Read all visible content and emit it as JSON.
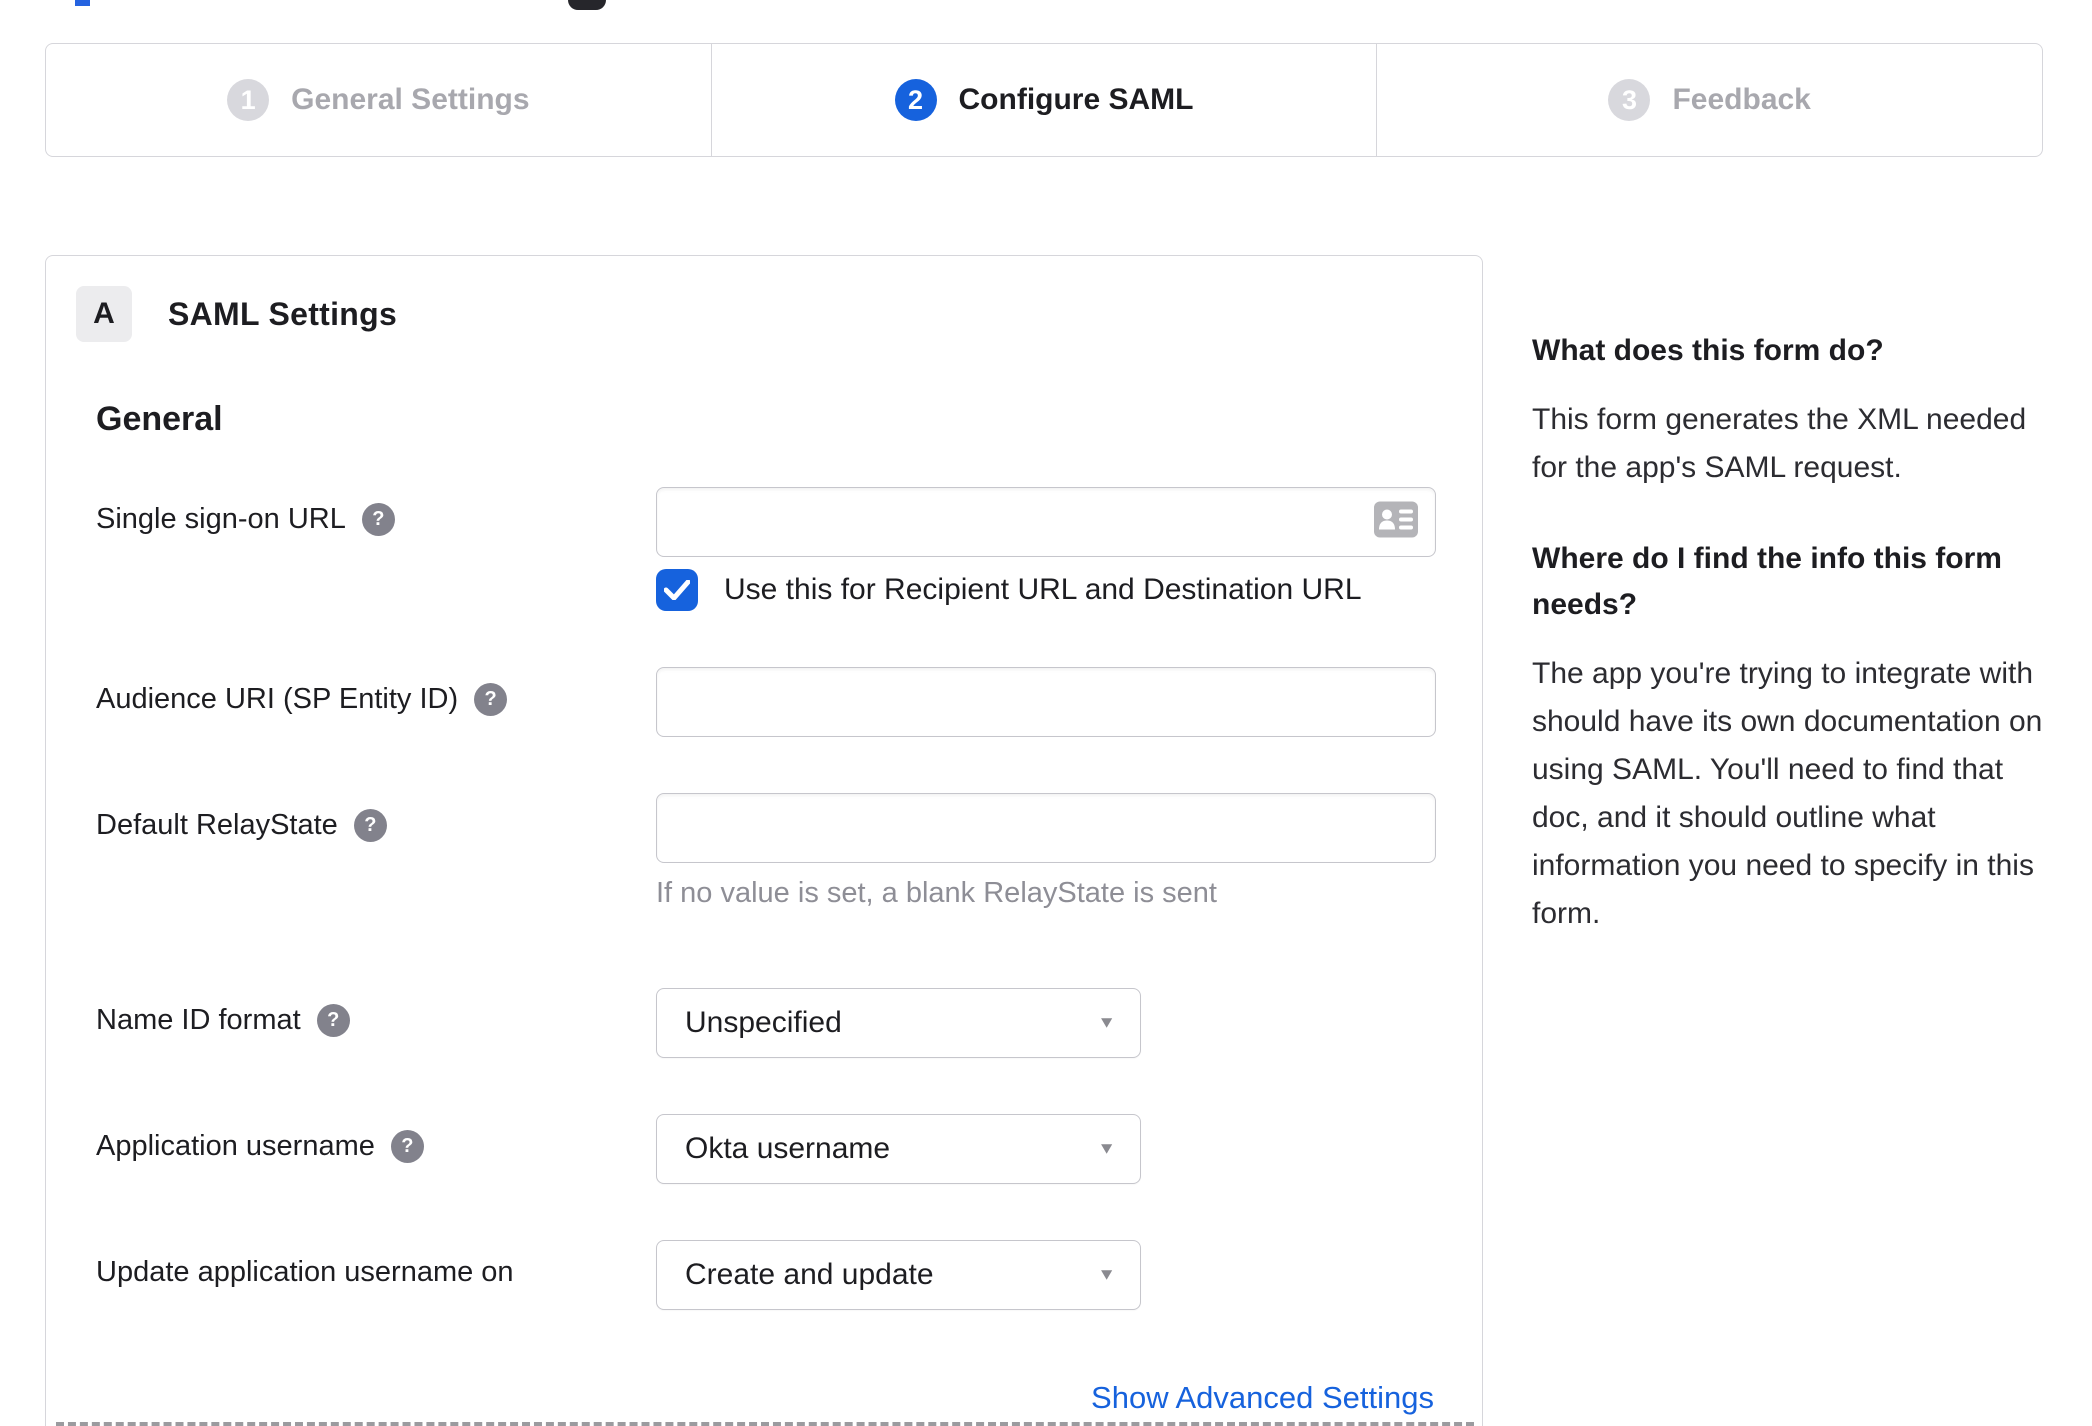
{
  "stepper": {
    "steps": [
      {
        "number": "1",
        "label": "General Settings",
        "state": "inactive"
      },
      {
        "number": "2",
        "label": "Configure SAML",
        "state": "active"
      },
      {
        "number": "3",
        "label": "Feedback",
        "state": "inactive"
      }
    ]
  },
  "panel": {
    "section_badge": "A",
    "section_title": "SAML Settings",
    "group_title": "General",
    "fields": {
      "sso_url": {
        "label": "Single sign-on URL",
        "value": "",
        "checkbox_label": "Use this for Recipient URL and Destination URL",
        "checkbox_checked": true
      },
      "audience_uri": {
        "label": "Audience URI (SP Entity ID)",
        "value": ""
      },
      "default_relaystate": {
        "label": "Default RelayState",
        "value": "",
        "hint": "If no value is set, a blank RelayState is sent"
      },
      "name_id_format": {
        "label": "Name ID format",
        "value": "Unspecified"
      },
      "app_username": {
        "label": "Application username",
        "value": "Okta username"
      },
      "update_app_username": {
        "label": "Update application username on",
        "value": "Create and update"
      }
    },
    "advanced_link": "Show Advanced Settings"
  },
  "sidebar": {
    "blocks": [
      {
        "heading": "What does this form do?",
        "body": "This form generates the XML needed for the app's SAML request."
      },
      {
        "heading": "Where do I find the info this form needs?",
        "body": "The app you're trying to integrate with should have its own documentation on using SAML. You'll need to find that doc, and it should outline what information you need to specify in this form."
      }
    ]
  },
  "icons": {
    "help_glyph": "?",
    "caret_glyph": "▼"
  },
  "colors": {
    "accent_blue": "#1662dd",
    "inactive_gray": "#a8a8ae",
    "text_dark": "#1d1d21",
    "border_gray": "#d6d6db",
    "hint_gray": "#8e8e96"
  }
}
